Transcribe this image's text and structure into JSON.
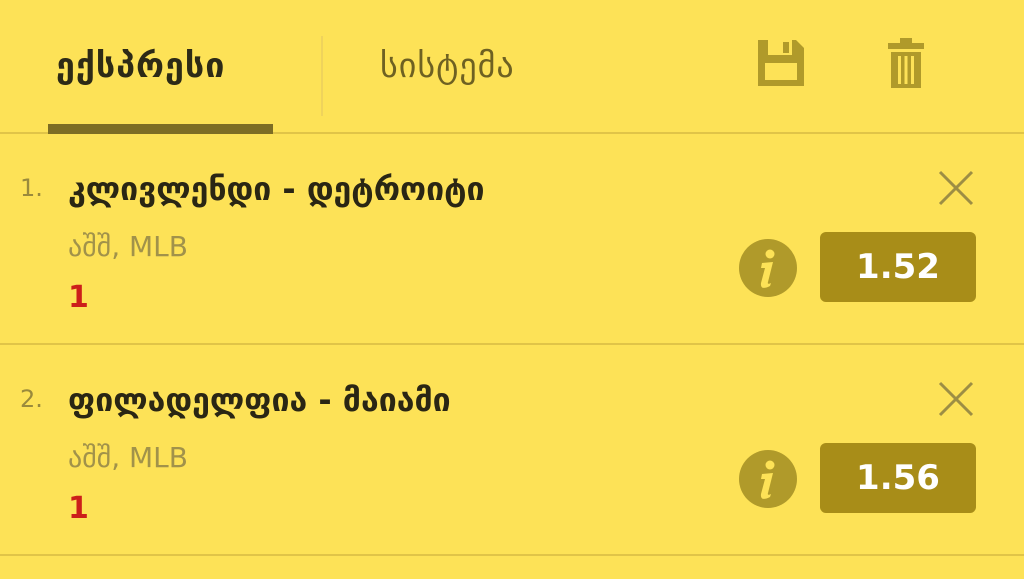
{
  "tabs": [
    {
      "label": "ექსპრესი",
      "active": true
    },
    {
      "label": "სისტემა",
      "active": false
    }
  ],
  "toolbar": {
    "save_icon": "floppy-disk-icon",
    "delete_icon": "trash-icon"
  },
  "bets": [
    {
      "number": "1.",
      "match": "კლივლენდი - დეტროიტი",
      "league": "აშშ, MLB",
      "outcome": "1",
      "odds": "1.52"
    },
    {
      "number": "2.",
      "match": "ფილადელფია - მაიამი",
      "league": "აშშ, MLB",
      "outcome": "1",
      "odds": "1.56"
    }
  ],
  "colors": {
    "background": "#fde257",
    "accent": "#a88d18",
    "outcome": "#cc1f1a"
  }
}
